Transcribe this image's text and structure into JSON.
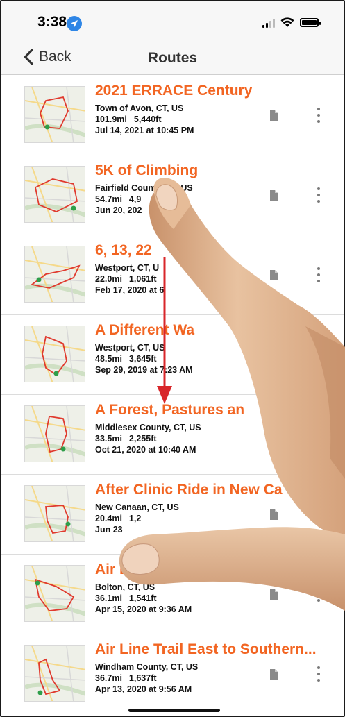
{
  "status_bar": {
    "time": "3:38"
  },
  "nav": {
    "back_label": "Back",
    "title": "Routes"
  },
  "routes": [
    {
      "title": "2021 ERRACE Century",
      "location": "Town of Avon, CT, US",
      "distance": "101.9mi",
      "elevation": "5,440ft",
      "date": "Jul 14, 2021 at 10:45 PM"
    },
    {
      "title": "5K of Climbing",
      "location": "Fairfield County, CT, US",
      "distance": "54.7mi",
      "elevation": "4,9",
      "date": "Jun 20, 202"
    },
    {
      "title": "6, 13, 22",
      "location": "Westport, CT, U",
      "distance": "22.0mi",
      "elevation": "1,061ft",
      "date": "Feb 17, 2020 at 6"
    },
    {
      "title": "A Different Wa",
      "location": "Westport, CT, US",
      "distance": "48.5mi",
      "elevation": "3,645ft",
      "date": "Sep 29, 2019 at 7:23 AM"
    },
    {
      "title": "A Forest, Pastures an",
      "location": "Middlesex County, CT, US",
      "distance": "33.5mi",
      "elevation": "2,255ft",
      "date": "Oct 21, 2020 at 10:40 AM"
    },
    {
      "title": "After Clinic Ride in New Ca",
      "location": "New Canaan, CT, US",
      "distance": "20.4mi",
      "elevation": "1,2",
      "date": "Jun 23"
    },
    {
      "title": "Air Line and",
      "location": "Bolton, CT, US",
      "distance": "36.1mi",
      "elevation": "1,541ft",
      "date": "Apr 15, 2020 at 9:36 AM"
    },
    {
      "title": "Air Line Trail East to Southern...",
      "location": "Windham County, CT, US",
      "distance": "36.7mi",
      "elevation": "1,637ft",
      "date": "Apr 13, 2020 at 9:56 AM"
    }
  ],
  "colors": {
    "accent": "#f26522",
    "arrow": "#d8262a",
    "skin": "#e0b38f"
  }
}
